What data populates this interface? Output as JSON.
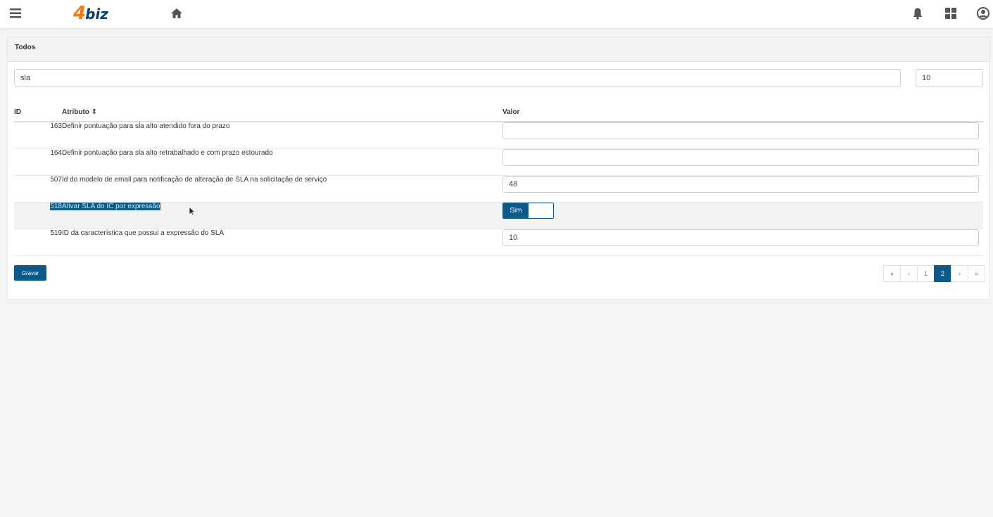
{
  "app": {
    "logo_num": "4",
    "logo_text": "biz"
  },
  "topbar": {
    "icons": [
      "menu-icon",
      "home-icon",
      "bell-icon",
      "apps-icon",
      "user-icon"
    ]
  },
  "panel": {
    "title": "Todos"
  },
  "search": {
    "value": "sla",
    "page_size": "10"
  },
  "table": {
    "headers": {
      "id": "ID",
      "attr": "Atributo ⇕",
      "value": "Valor"
    },
    "rows": [
      {
        "id": "163",
        "attr": "Definir pontuação para sla alto atendido fora do prazo",
        "value": ""
      },
      {
        "id": "164",
        "attr": "Definir pontuação para sla alto retrabalhado e com prazo estourado",
        "value": ""
      },
      {
        "id": "507",
        "attr": "Id do modelo de email para notificação de alteração de SLA na solicitação de serviço",
        "value": "48"
      },
      {
        "id": "518",
        "attr": "Ativar SLA do IC por expressão",
        "value": "Sim"
      },
      {
        "id": "519",
        "attr": "ID da característica que possui a expressão do SLA",
        "value": "10"
      }
    ]
  },
  "actions": {
    "save_label": "Gravar"
  },
  "pagination": {
    "first": "«",
    "prev": "‹",
    "pages": [
      "1",
      "2"
    ],
    "current": "2",
    "next": "›",
    "last": "»"
  },
  "colors": {
    "primary": "#0b5a8a",
    "logo_orange": "#f07a1e",
    "logo_navy": "#0c3d6b"
  }
}
